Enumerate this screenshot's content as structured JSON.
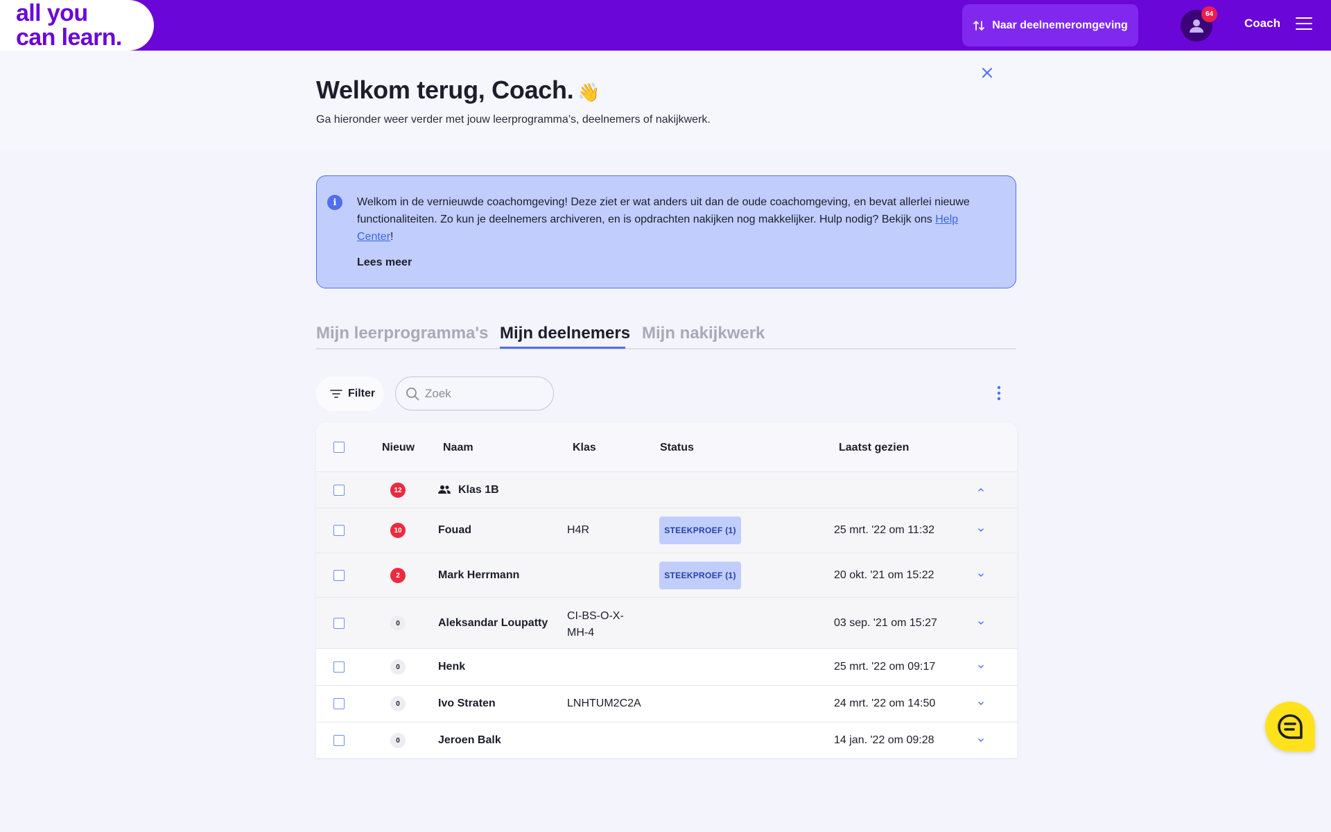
{
  "header": {
    "logo_line1": "all you",
    "logo_line2": "can learn.",
    "switch_label": "Naar deelnemeromgeving",
    "notification_count": "64",
    "user_name": "Coach"
  },
  "welcome": {
    "title": "Welkom terug, Coach.",
    "emoji": "👋",
    "subtitle": "Ga hieronder weer verder met jouw leerprogramma’s, deelnemers of nakijkwerk."
  },
  "info_banner": {
    "icon_glyph": "i",
    "text_before_link": "Welkom in de vernieuwde coachomgeving! Deze ziet er wat anders uit dan de oude coachomgeving, en bevat allerlei nieuwe functionaliteiten. Zo kun je deelnemers archiveren, en is opdrachten nakijken nog makkelijker. Hulp nodig? Bekijk ons ",
    "link_text": "Help Center",
    "text_after_link": "!",
    "read_more": "Lees meer"
  },
  "tabs": [
    {
      "label": "Mijn leerprogramma's",
      "active": false
    },
    {
      "label": "Mijn deelnemers",
      "active": true
    },
    {
      "label": "Mijn nakijkwerk",
      "active": false
    }
  ],
  "toolbar": {
    "filter_label": "Filter",
    "search_placeholder": "Zoek"
  },
  "table": {
    "columns": {
      "new": "Nieuw",
      "name": "Naam",
      "class": "Klas",
      "status": "Status",
      "last_seen": "Laatst gezien"
    },
    "group": {
      "name": "Klas 1B",
      "count": "12"
    },
    "rows": [
      {
        "count": "10",
        "name": "Fouad",
        "class": "H4R",
        "status": "STEEKPROEF (1)",
        "last_seen": "25 mrt. '22 om 11:32"
      },
      {
        "count": "2",
        "name": "Mark Herrmann",
        "class": "",
        "status": "STEEKPROEF (1)",
        "last_seen": "20 okt. '21 om 15:22"
      },
      {
        "count": "0",
        "name": "Aleksandar Loupatty",
        "class_line1": "CI-BS-O-X-",
        "class_line2": "MH-4",
        "status": "",
        "last_seen": "03 sep. '21 om 15:27"
      },
      {
        "count": "0",
        "name": "Henk",
        "class": "",
        "status": "",
        "last_seen": "25 mrt. '22 om 09:17"
      },
      {
        "count": "0",
        "name": "Ivo Straten",
        "class": "LNHTUM2C2A",
        "status": "",
        "last_seen": "24 mrt. '22 om 14:50"
      },
      {
        "count": "0",
        "name": "Jeroen Balk",
        "class": "",
        "status": "",
        "last_seen": "14 jan. '22 om 09:28"
      }
    ]
  },
  "colors": {
    "brand_purple": "#6a06d8",
    "accent_blue": "#4f6ff0",
    "badge_red": "#ec2a3e",
    "chat_yellow": "#ffe21c"
  }
}
